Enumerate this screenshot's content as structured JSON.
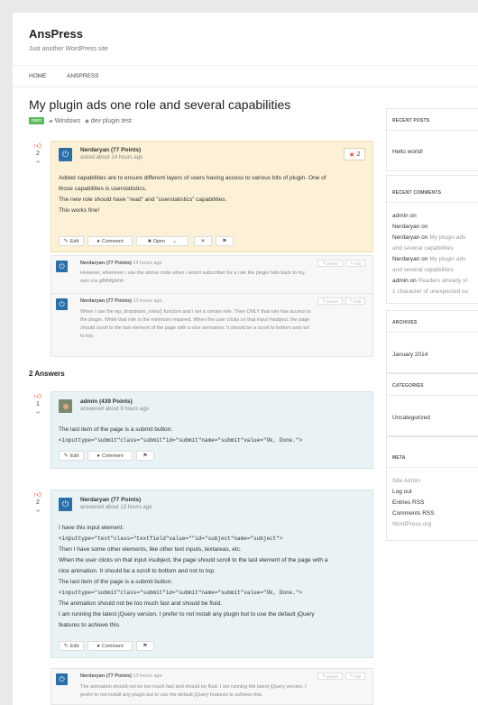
{
  "site": {
    "title": "AnsPress",
    "tagline": "Just another WordPress site"
  },
  "nav": {
    "items": [
      "HOME",
      "ANSPRESS"
    ]
  },
  "question": {
    "title": "My plugin ads one role and several capabilities",
    "status_badge": "open",
    "category": "Windows",
    "tag": "dev plugin test",
    "votes": "2",
    "author": "Nerdaryan (77 Points)",
    "time": "asked about 14 hours ago",
    "favorites": "2",
    "body": [
      "Added capabilities are to ensure different layers of users having access to various bits of plugin. One of",
      "those capabilities is userstatistics.",
      "The new role should have \"read\" and \"userstatistics\" capabilities.",
      "This works fine!"
    ],
    "actions": {
      "edit": "Edit",
      "comment": "Comment",
      "status": "Open"
    }
  },
  "comments_q": [
    {
      "author": "Nerdaryan (77 Points)",
      "time": "14 hours ago",
      "lines": [
        "However, whenever i use the above code when i select subscriber for a role the plugin falls back to my",
        "own cre gfhfhfgfxhh"
      ]
    },
    {
      "author": "Nerdaryan (77 Points)",
      "time": "13 hours ago",
      "lines": [
        "When i use the wp_dropdown_roles() function and i set a certain role. Then ONLY that role has access to",
        "the plugin. While that role is the minimum required. When the user clicks on that input #subject, the page",
        "should scroll to the last element of the page with a nice animation. It should be a scroll to bottom and not",
        "to top."
      ]
    }
  ],
  "comment_actions": {
    "delete": "Delete",
    "edit": "Edit"
  },
  "answers_heading": "2 Answers",
  "answers": [
    {
      "votes": "1",
      "author": "admin (439 Points)",
      "time": "answered about 9 hours ago",
      "lines": [
        "The last item of the page is a submit button:",
        "<inputtype=\"submit\"class=\"submit\"id=\"submit\"name=\"submit\"value=\"Ok, Done.\">"
      ],
      "actions": {
        "edit": "Edit",
        "comment": "Comment"
      }
    },
    {
      "votes": "2",
      "author": "Nerdaryan (77 Points)",
      "time": "answered about 13 hours ago",
      "lines": [
        "I have this input element:",
        "<inputtype=\"text\"class=\"textfield\"value=\"\"id=\"subject\"name=\"subject\">",
        "Then I have some other elements, like other text inputs, textareas, etc.",
        "When the user clicks on that input #subject, the page should scroll to the last element of the page with a",
        "nice animation. It should be a scroll to bottom and not to top.",
        "The last item of the page is a submit button:",
        "<inputtype=\"submit\"class=\"submit\"id=\"submit\"name=\"submit\"value=\"Ok, Done.\">",
        "The animation should not be too much fast and should be fluid.",
        "I am running the latest jQuery version. I prefer to not install any plugin but to use the default jQuery",
        "features to achieve this."
      ],
      "actions": {
        "edit": "Edit",
        "comment": "Comment"
      },
      "comment": {
        "author": "Nerdaryan (77 Points)",
        "time": "13 hours ago",
        "lines": [
          "The animation should not be too much fast and should be fluid. I am running the latest jQuery version. I",
          "prefer to not install any plugin but to use the default jQuery features to achieve this."
        ]
      }
    }
  ],
  "sidebar": {
    "recent_posts": {
      "title": "RECENT POSTS",
      "items": [
        "Hello world!"
      ]
    },
    "recent_comments": {
      "title": "RECENT COMMENTS",
      "items": [
        {
          "author": "admin",
          "on": "on",
          "post": ""
        },
        {
          "author": "Nerdaryan",
          "on": "on",
          "post": ""
        },
        {
          "author": "Nerdaryan",
          "on": "on",
          "post": "My plugin ads"
        },
        {
          "cont": "and several capabilities"
        },
        {
          "author": "Nerdaryan",
          "on": "on",
          "post": "My plugin ads"
        },
        {
          "cont": "and several capabilities"
        },
        {
          "author": "admin",
          "on": "on",
          "post": "Readers already st"
        },
        {
          "cont": "1 character of unexpected ou"
        }
      ]
    },
    "archives": {
      "title": "ARCHIVES",
      "items": [
        "January 2014"
      ]
    },
    "categories": {
      "title": "CATEGORIES",
      "items": [
        "Uncategorized"
      ]
    },
    "meta": {
      "title": "META",
      "items": [
        "Site Admin",
        "Log out",
        "Entries RSS",
        "Comments RSS",
        "WordPress.org"
      ]
    }
  },
  "icons": {
    "thumb": "thumbs-up-icon",
    "comment": "comment-bubble-icon",
    "star": "star-icon",
    "edit": "pencil-icon",
    "close": "close-icon",
    "flag": "flag-icon",
    "folder": "folder-icon",
    "tag": "tag-icon"
  },
  "colors": {
    "vote_accent": "#e74c3c",
    "avatar": "#2a6fa8",
    "open_badge": "#5cb85c",
    "question_bg": "#fcf1d6",
    "answer_bg": "#e9f2f4"
  }
}
